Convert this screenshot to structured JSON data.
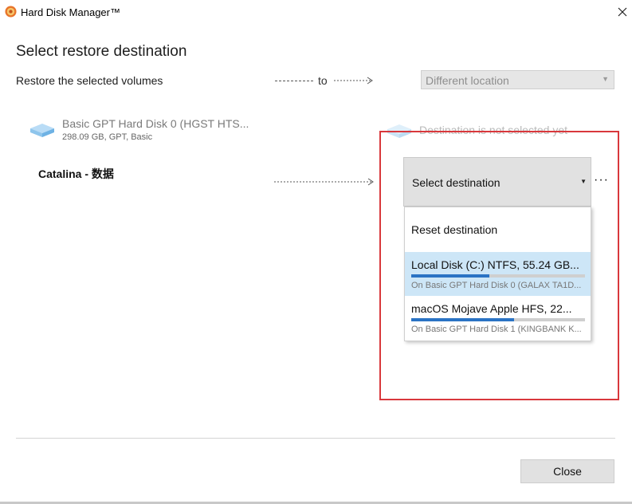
{
  "window": {
    "title": "Hard Disk Manager™"
  },
  "page": {
    "heading": "Select restore destination",
    "restore_label": "Restore the selected volumes",
    "to_label": "to",
    "location_select": {
      "selected": "Different location"
    }
  },
  "source": {
    "disk_name": "Basic GPT Hard Disk 0 (HGST HTS...",
    "disk_info": "298.09 GB, GPT, Basic",
    "volume_name": "Catalina - 数据"
  },
  "destination": {
    "status_text": "Destination is not selected yet",
    "select_button_label": "Select destination",
    "more_label": "···",
    "menu": {
      "reset_label": "Reset destination",
      "items": [
        {
          "title": "Local Disk (C:) NTFS, 55.24 GB...",
          "subtitle": "On Basic GPT Hard Disk 0 (GALAX TA1D...",
          "usage_fraction": 0.45,
          "selected": true
        },
        {
          "title": "macOS Mojave Apple HFS, 22...",
          "subtitle": "On Basic GPT Hard Disk 1 (KINGBANK K...",
          "usage_fraction": 0.59,
          "selected": false
        }
      ]
    }
  },
  "footer": {
    "close_label": "Close"
  },
  "colors": {
    "accent_bar": "#2a73c4",
    "selection_bg": "#cde6f7",
    "highlight_border": "#d9383c",
    "disk_icon": "#8ec5ec"
  }
}
